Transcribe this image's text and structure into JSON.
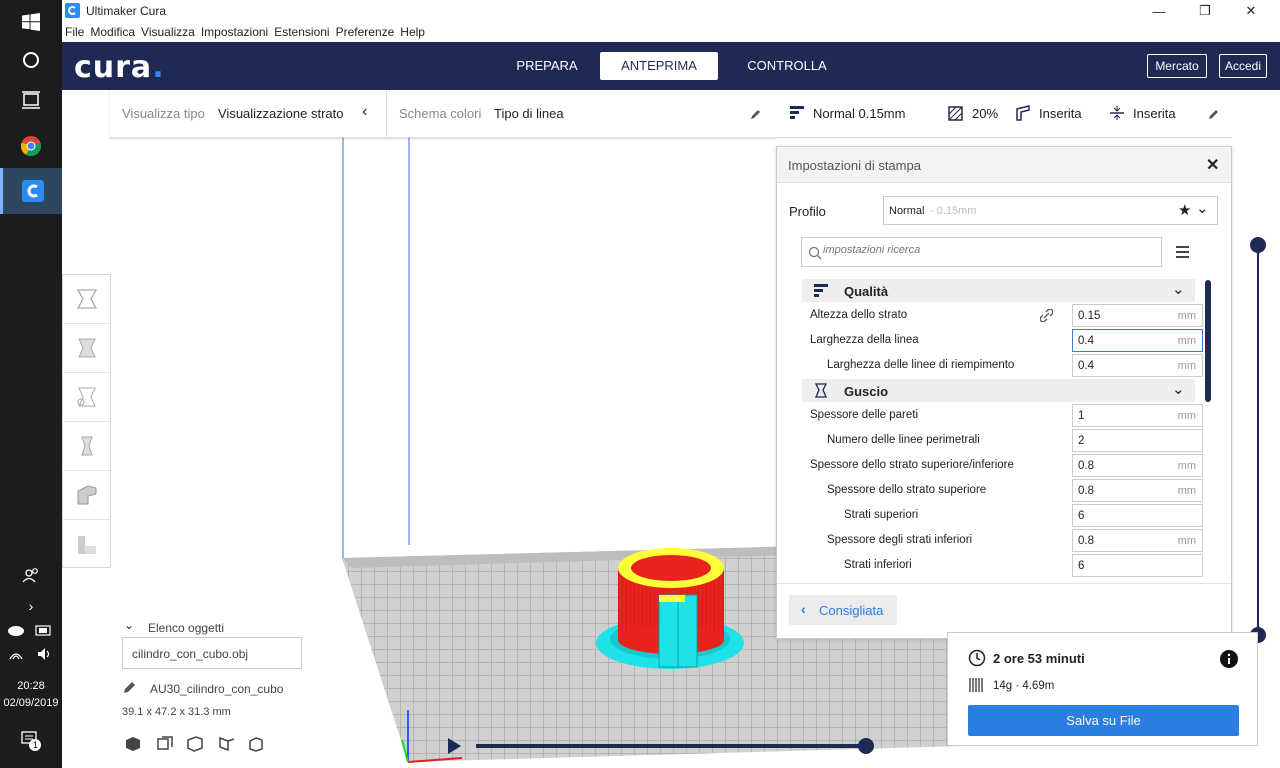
{
  "window": {
    "title": "Ultimaker Cura"
  },
  "menu": [
    "File",
    "Modifica",
    "Visualizza",
    "Impostazioni",
    "Estensioni",
    "Preferenze",
    "Help"
  ],
  "taskbar": {
    "time": "20:28",
    "date": "02/09/2019",
    "notif_count": "1"
  },
  "header": {
    "logo": "cura",
    "stages": [
      "PREPARA",
      "ANTEPRIMA",
      "CONTROLLA"
    ],
    "active_stage": "ANTEPRIMA",
    "market": "Mercato",
    "login": "Accedi"
  },
  "viewbar": {
    "view_type_label": "Visualizza tipo",
    "view_type_value": "Visualizzazione strato",
    "color_scheme_label": "Schema colori",
    "color_scheme_value": "Tipo di linea"
  },
  "settingsbar": {
    "profile": "Normal 0.15mm",
    "infill": "20%",
    "support": "Inserita",
    "adhesion": "Inserita"
  },
  "panel": {
    "title": "Impostazioni di stampa",
    "profile_label": "Profilo",
    "profile_name": "Normal",
    "profile_detail": " - 0.15mm",
    "search_placeholder": "impostazioni ricerca",
    "categories": {
      "quality": "Qualità",
      "shell": "Guscio"
    },
    "rows": [
      {
        "label": "Altezza dello strato",
        "value": "0.15",
        "unit": "mm"
      },
      {
        "label": "Larghezza della linea",
        "value": "0.4",
        "unit": "mm"
      },
      {
        "label": "Larghezza delle linee di riempimento",
        "value": "0.4",
        "unit": "mm"
      },
      {
        "label": "Spessore delle pareti",
        "value": "1",
        "unit": "mm"
      },
      {
        "label": "Numero delle linee perimetrali",
        "value": "2",
        "unit": ""
      },
      {
        "label": "Spessore dello strato superiore/inferiore",
        "value": "0.8",
        "unit": "mm"
      },
      {
        "label": "Spessore dello strato superiore",
        "value": "0.8",
        "unit": "mm"
      },
      {
        "label": "Strati superiori",
        "value": "6",
        "unit": ""
      },
      {
        "label": "Spessore degli strati inferiori",
        "value": "0.8",
        "unit": "mm"
      },
      {
        "label": "Strati inferiori",
        "value": "6",
        "unit": ""
      }
    ],
    "recommended": "Consigliata"
  },
  "objects": {
    "header": "Elenco oggetti",
    "file": "cilindro_con_cubo.obj",
    "job_name": "AU30_cilindro_con_cubo",
    "dimensions": "39.1 x 47.2 x 31.3 mm"
  },
  "estimate": {
    "time": "2 ore 53 minuti",
    "material": "14g · 4.69m",
    "save": "Salva su File"
  },
  "colors": {
    "header_bg": "#1e2a54",
    "accent": "#2a7de1",
    "model_wall": "#e8231b",
    "model_support": "#1fe2e8",
    "model_top": "#ffff3a"
  }
}
